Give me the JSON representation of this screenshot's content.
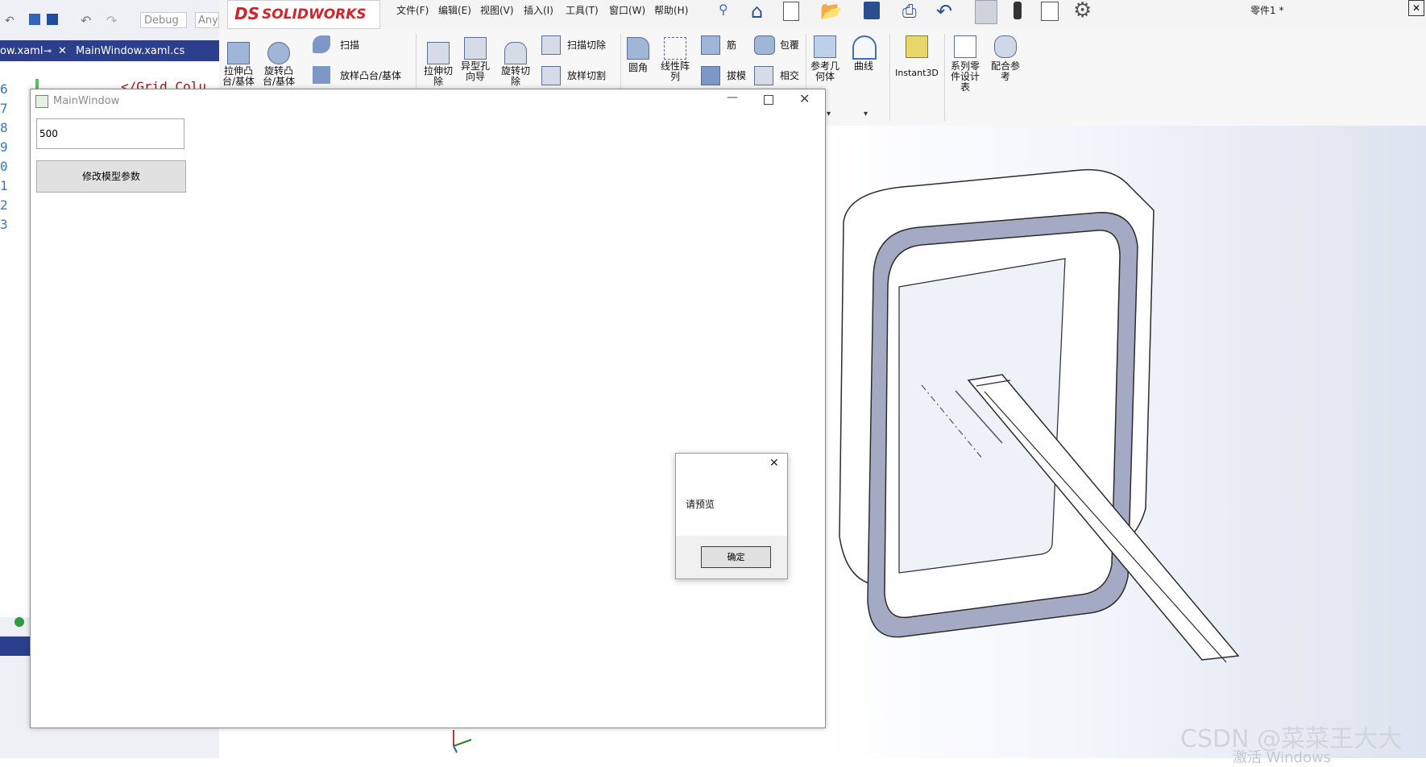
{
  "vs": {
    "config": "Debug",
    "platform": "Any",
    "tabs": [
      "ow.xaml",
      "MainWindow.xaml.cs"
    ],
    "line_numbers": [
      "6",
      "7",
      "8",
      "9",
      "0",
      "1",
      "2",
      "3"
    ],
    "code_snippet": "</Grid.Colu"
  },
  "solidworks": {
    "logo_text": "SOLIDWORKS",
    "menu": [
      "文件(F)",
      "编辑(E)",
      "视图(V)",
      "插入(I)",
      "工具(T)",
      "窗口(W)",
      "帮助(H)"
    ],
    "doc_title": "零件1 *",
    "ribbon": {
      "extrude_boss": "拉伸凸\n台/基体",
      "revolve_boss": "旋转凸\n台/基体",
      "sweep": "扫描",
      "loft_boss": "放样凸台/基体",
      "extrude_cut": "拉伸切\n除",
      "hole_wizard": "异型孔\n向导",
      "revolve_cut": "旋转切\n除",
      "sweep_cut": "扫描切除",
      "loft_cut": "放样切割",
      "fillet": "圆角",
      "linear_pattern": "线性阵\n列",
      "rib": "筋",
      "draft": "拔模",
      "wrap": "包覆",
      "intersect": "相交",
      "ref_geometry": "参考几\n何体",
      "curves": "曲线",
      "instant3d": "Instant3D",
      "design_table": "系列零\n件设计\n表",
      "mate_ref": "配合参\n考"
    }
  },
  "wpf_window": {
    "title": "MainWindow",
    "input_value": "500",
    "button_label": "修改模型参数"
  },
  "message_box": {
    "text": "请预览",
    "ok_label": "确定"
  },
  "watermark": "CSDN @菜菜王大大",
  "activate_text": "激活 Windows"
}
